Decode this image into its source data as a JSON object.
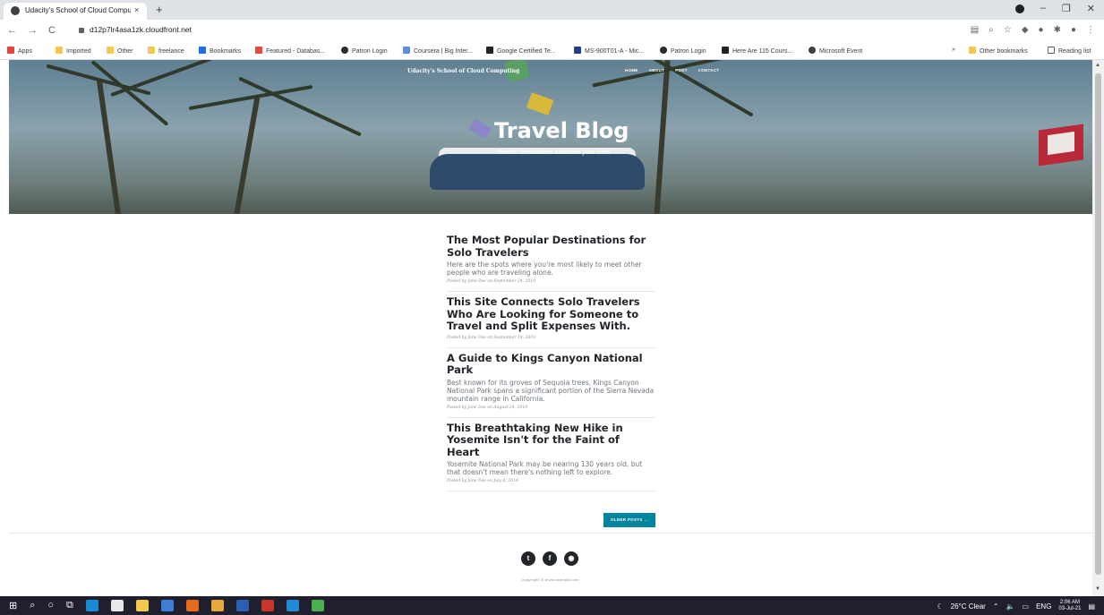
{
  "browser": {
    "tab_title": "Udacity's School of Cloud Compu",
    "tab_close": "×",
    "new_tab": "+",
    "url": "d12p7lr4asa1zk.cloudfront.net",
    "nav": {
      "back": "←",
      "forward": "→",
      "reload": "C"
    },
    "window_controls": {
      "minimize": "–",
      "restore": "❐",
      "close": "✕"
    },
    "bookmarks": [
      "Apps",
      "Imported",
      "Other",
      "freelance",
      "Bookmarks",
      "Featured - Databas...",
      "Patron Login",
      "Coursera | Big Inter...",
      "Google Certified Te...",
      "MS-900T01-A - Mic...",
      "Patron Login",
      "Here Are 115 Cours...",
      "Microsoft Event"
    ],
    "bookmarks_overflow": "»",
    "other_bookmarks": "Other bookmarks",
    "reading_list": "Reading list"
  },
  "site": {
    "brand": "Udacity's School of Cloud Computing",
    "nav": [
      "HOME",
      "ABOUT",
      "POST",
      "CONTACT"
    ],
    "hero_title": "Travel Blog",
    "hero_subtitle": "Search destinations and book your hotel"
  },
  "posts": [
    {
      "title": "The Most Popular Destinations for Solo Travelers",
      "subtitle": "Here are the spots where you're most likely to meet other people who are traveling alone.",
      "meta": "Posted by Jane Doe on September 24, 2019"
    },
    {
      "title": "This Site Connects Solo Travelers Who Are Looking for Someone to Travel and Split Expenses With.",
      "subtitle": "",
      "meta": "Posted by Jane Doe on September 18, 2019"
    },
    {
      "title": "A Guide to Kings Canyon National Park",
      "subtitle": "Best known for its groves of Sequoia trees, Kings Canyon National Park spans a significant portion of the Sierra Nevada mountain range in California.",
      "meta": "Posted by Jane Doe on August 24, 2019"
    },
    {
      "title": "This Breathtaking New Hike in Yosemite Isn't for the Faint of Heart",
      "subtitle": "Yosemite National Park may be nearing 130 years old, but that doesn't mean there's nothing left to explore.",
      "meta": "Posted by Jane Doe on July 8, 2019"
    }
  ],
  "older_posts": "OLDER POSTS →",
  "footer": {
    "social": [
      "twitter-icon",
      "facebook-icon",
      "github-icon"
    ],
    "copyright": "Copyright © www.example.com"
  },
  "taskbar": {
    "weather": "26°C Clear",
    "lang": "ENG",
    "time": "2:06 AM",
    "date": "03-Jul-21"
  }
}
